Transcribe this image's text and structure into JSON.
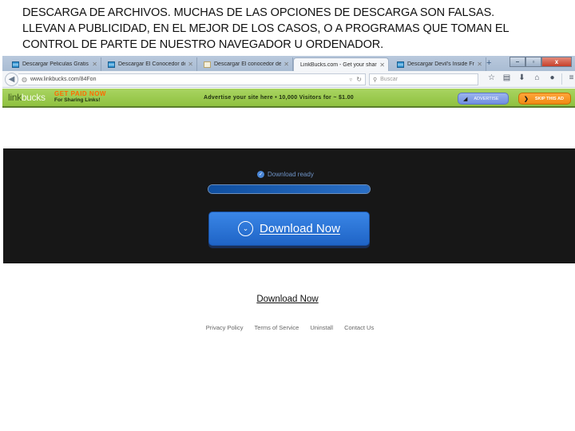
{
  "caption": {
    "lines": [
      "DESCARGA DE ARCHIVOS. MUCHAS DE LAS OPCIONES DE DESCARGA SON FALSAS.",
      "LLEVAN A PUBLICIDAD, EN EL MEJOR DE LOS CASOS, O A PROGRAMAS QUE TOMAN EL",
      "CONTROL DE PARTE DE NUESTRO NAVEGADOR U ORDENADOR."
    ]
  },
  "browser": {
    "tabs": [
      {
        "title": "Descargar Peliculas Gratis Fu...",
        "icon": "film-icon",
        "active": false
      },
      {
        "title": "Descargar El Conocedor del L...",
        "icon": "film-icon",
        "active": false
      },
      {
        "title": "Descargar El conocedor del la...",
        "icon": "document-icon",
        "active": false
      },
      {
        "title": "LinkBucks.com - Get your share",
        "icon": "linkbucks-icon",
        "active": true
      },
      {
        "title": "Descargar Devil's Inside Fri...",
        "icon": "film-icon",
        "active": false
      }
    ],
    "new_tab": "+",
    "window_controls": {
      "minimize": "–",
      "maximize": "▫",
      "close": "x"
    },
    "url": "www.linkbucks.com/84Fon",
    "search_placeholder": "Buscar",
    "toolbar_icons": [
      "bookmark-star-icon",
      "reading-list-icon",
      "downloads-icon",
      "home-icon",
      "sync-icon",
      "menu-icon"
    ]
  },
  "adbar": {
    "logo_link": "link",
    "logo_bucks": "bucks",
    "promo_line1": "GET PAID NOW",
    "promo_line2": "For Sharing Links!",
    "advert_text": "Advertise your site here • 10,000 Visitors for ~ $1.00",
    "advertise_label": "ADVERTISE",
    "skip_label": "SKIP THIS AD"
  },
  "download": {
    "status": "Download ready",
    "progress_percent": 100,
    "main_button": "Download Now",
    "text_link": "Download Now",
    "footer_links": [
      "Privacy Policy",
      "Terms of Service",
      "Uninstall",
      "Contact Us"
    ]
  },
  "colors": {
    "ad_green": "#9acb4d",
    "download_blue": "#2a74d8",
    "hero_bg": "#171717",
    "skip_orange": "#f7941d"
  }
}
